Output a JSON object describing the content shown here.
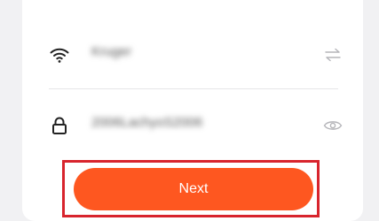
{
  "wifi": {
    "icon": "wifi-icon",
    "ssid": "Kruger",
    "switch_icon": "switch-network-icon"
  },
  "password": {
    "icon": "lock-icon",
    "value": "2006LachyoS2006",
    "toggle_icon": "eye-icon"
  },
  "next_button": {
    "label": "Next"
  },
  "colors": {
    "accent": "#fe5720",
    "highlight": "#d8242d",
    "background": "#f1f1f3"
  }
}
